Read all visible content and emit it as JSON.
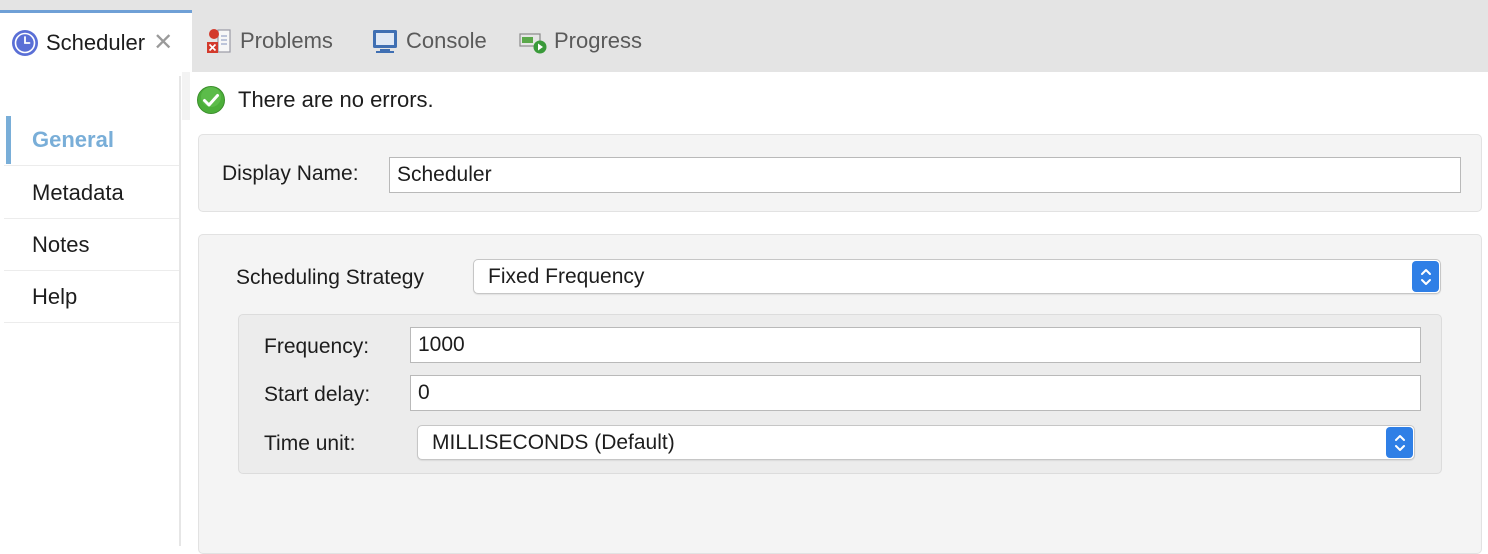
{
  "tabs": [
    {
      "label": "Scheduler",
      "icon": "clock-icon",
      "active": true
    },
    {
      "label": "Problems",
      "icon": "problems-icon"
    },
    {
      "label": "Console",
      "icon": "console-icon"
    },
    {
      "label": "Progress",
      "icon": "progress-icon"
    }
  ],
  "sidebar": {
    "items": [
      {
        "label": "General",
        "selected": true
      },
      {
        "label": "Metadata"
      },
      {
        "label": "Notes"
      },
      {
        "label": "Help"
      }
    ]
  },
  "status": {
    "text": "There are no errors.",
    "icon": "check-circle-icon"
  },
  "form": {
    "display_name_label": "Display Name:",
    "display_name_value": "Scheduler",
    "strategy_label": "Scheduling Strategy",
    "strategy_value": "Fixed Frequency",
    "frequency_label": "Frequency:",
    "frequency_value": "1000",
    "start_delay_label": "Start delay:",
    "start_delay_value": "0",
    "time_unit_label": "Time unit:",
    "time_unit_value": "MILLISECONDS (Default)"
  },
  "colors": {
    "accent": "#79aed8",
    "select_stepper": "#2f7fe6",
    "ok_green": "#4caf3a"
  }
}
